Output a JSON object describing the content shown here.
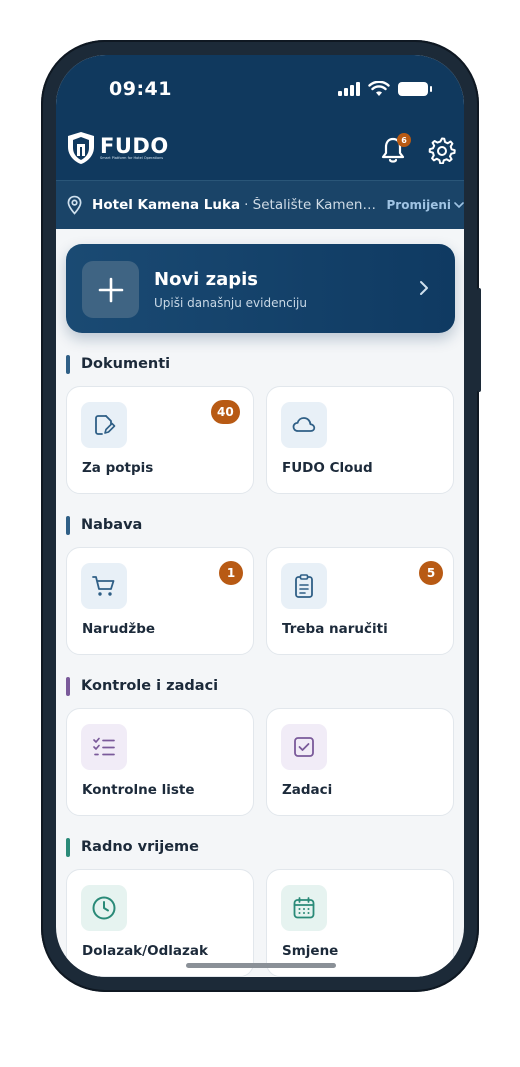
{
  "status": {
    "time": "09:41"
  },
  "brand": {
    "name": "FUDO",
    "tagline": "Smart Platform for Hotel Operations"
  },
  "notifications": {
    "count": "6"
  },
  "hotel": {
    "name": "Hotel Kamena Luka",
    "separator": "·",
    "address": "Šetalište Kamena…",
    "change_label": "Promijeni"
  },
  "new_entry": {
    "title": "Novi zapis",
    "subtitle": "Upiši današnju evidenciju"
  },
  "sections": [
    {
      "title": "Dokumenti",
      "accent": "#2f5f86",
      "tiles": [
        {
          "label": "Za potpis",
          "icon": "sign-document-icon",
          "badge": "40"
        },
        {
          "label": "FUDO Cloud",
          "icon": "cloud-icon",
          "badge": null
        }
      ]
    },
    {
      "title": "Nabava",
      "accent": "#2f5f86",
      "tiles": [
        {
          "label": "Narudžbe",
          "icon": "cart-icon",
          "badge": "1"
        },
        {
          "label": "Treba naručiti",
          "icon": "clipboard-list-icon",
          "badge": "5"
        }
      ]
    },
    {
      "title": "Kontrole i zadaci",
      "accent": "#7a5a9a",
      "tiles": [
        {
          "label": "Kontrolne liste",
          "icon": "checklist-icon",
          "badge": null
        },
        {
          "label": "Zadaci",
          "icon": "check-square-icon",
          "badge": null
        }
      ]
    },
    {
      "title": "Radno vrijeme",
      "accent": "#2a8a78",
      "tiles": [
        {
          "label": "Dolazak/Odlazak",
          "icon": "clock-icon",
          "badge": null
        },
        {
          "label": "Smjene",
          "icon": "calendar-icon",
          "badge": null
        }
      ]
    }
  ],
  "colors": {
    "primary": "#10395e",
    "badge": "#b85a14",
    "blue_tint": "#e8f0f7",
    "purple_tint": "#f1ecf7",
    "teal_tint": "#e6f3f0"
  }
}
